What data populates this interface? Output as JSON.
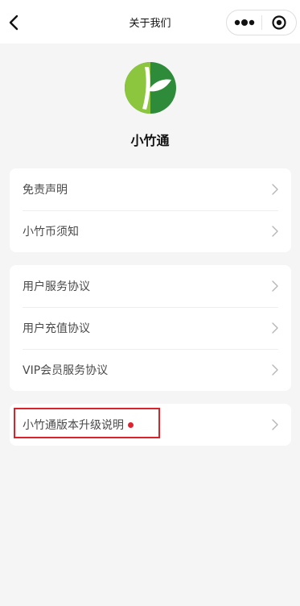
{
  "nav": {
    "title": "关于我们",
    "back_icon": "chevron-left-icon",
    "more_icon": "more-dots-icon",
    "close_icon": "target-circle-icon"
  },
  "app": {
    "name": "小竹通",
    "logo_icon": "bamboo-leaf-logo",
    "brand_colors": [
      "#8cc63f",
      "#2e8b3a"
    ]
  },
  "groups": [
    {
      "items": [
        {
          "label": "免责声明"
        },
        {
          "label": "小竹币须知"
        }
      ]
    },
    {
      "items": [
        {
          "label": "用户服务协议"
        },
        {
          "label": "用户充值协议"
        },
        {
          "label": "VIP会员服务协议"
        }
      ]
    },
    {
      "items": [
        {
          "label": "小竹通版本升级说明",
          "has_new_dot": true,
          "highlighted": true
        }
      ]
    }
  ],
  "colors": {
    "background": "#f5f5f5",
    "card": "#ffffff",
    "new_dot": "#e3202f",
    "highlight_border": "#d9222a"
  }
}
